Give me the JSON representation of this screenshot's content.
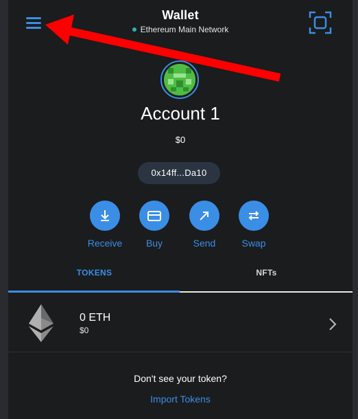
{
  "header": {
    "title": "Wallet",
    "network": "Ethereum Main Network"
  },
  "account": {
    "name": "Account 1",
    "balance": "$0",
    "address": "0x14ff...Da10"
  },
  "actions": [
    {
      "label": "Receive",
      "icon": "download-icon"
    },
    {
      "label": "Buy",
      "icon": "card-icon"
    },
    {
      "label": "Send",
      "icon": "send-arrow-icon"
    },
    {
      "label": "Swap",
      "icon": "swap-icon"
    }
  ],
  "tabs": {
    "tokens": "TOKENS",
    "nfts": "NFTs"
  },
  "tokens": [
    {
      "amount": "0 ETH",
      "fiat": "$0",
      "icon": "ethereum-icon"
    }
  ],
  "footer": {
    "prompt": "Don't see your token?",
    "import_link": "Import Tokens"
  },
  "colors": {
    "background": "#1b1c1e",
    "accent": "#3a8ee6",
    "network_dot": "#29b6af",
    "annotation_arrow": "#ff0000"
  }
}
